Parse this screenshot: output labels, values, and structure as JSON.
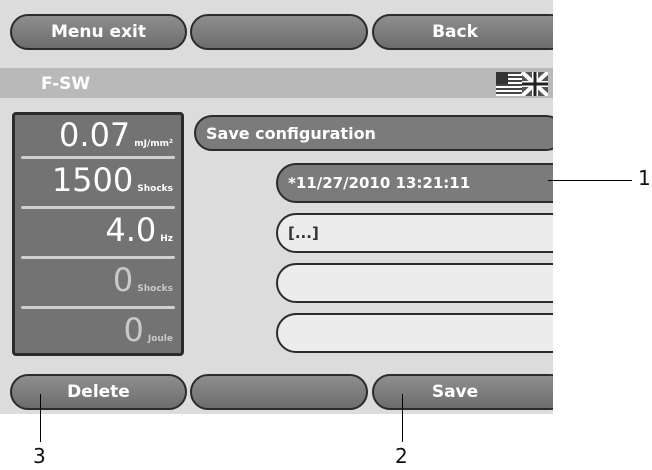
{
  "top_buttons": {
    "menu_exit": "Menu exit",
    "middle": "",
    "back": "Back"
  },
  "status_bar": {
    "title": "F-SW",
    "language_icon": "uk-us-flag-icon"
  },
  "parameters": [
    {
      "value": "0.07",
      "unit": "mJ/mm²"
    },
    {
      "value": "1500",
      "unit": "Shocks"
    },
    {
      "value": "4.0",
      "unit": "Hz"
    },
    {
      "value": "0",
      "unit": "Shocks"
    },
    {
      "value": "0",
      "unit": "Joule"
    }
  ],
  "config": {
    "header": "Save configuration",
    "entries": [
      "*11/27/2010 13:21:11",
      "[...]",
      "",
      ""
    ]
  },
  "bottom_buttons": {
    "delete": "Delete",
    "middle": "",
    "save": "Save"
  },
  "callouts": {
    "one": "1",
    "two": "2",
    "three": "3"
  },
  "colors": {
    "button": "#7b7b7b",
    "screen_bg": "#dcdcdc",
    "panel_bg": "#737373",
    "entry_bg": "#ececec"
  }
}
